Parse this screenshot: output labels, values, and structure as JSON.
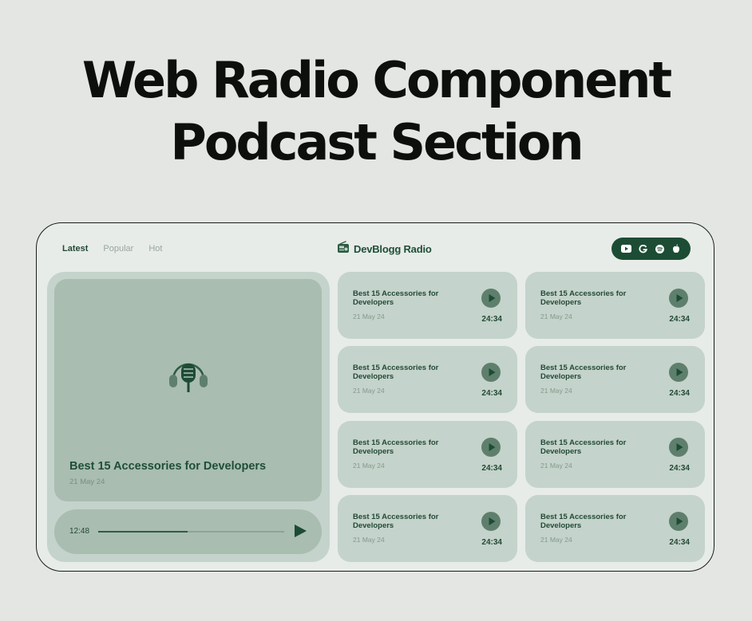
{
  "headline": {
    "line1": "Web Radio Component",
    "line2": "Podcast Section"
  },
  "header": {
    "tabs": [
      {
        "label": "Latest",
        "active": true
      },
      {
        "label": "Popular",
        "active": false
      },
      {
        "label": "Hot",
        "active": false
      }
    ],
    "brand": {
      "icon": "radio-icon",
      "name": "DevBlogg Radio"
    },
    "platforms": [
      "youtube-icon",
      "google-icon",
      "spotify-icon",
      "apple-icon"
    ]
  },
  "featured": {
    "icon": "podcast-microphone-headphones-icon",
    "title": "Best 15 Accessories for Developers",
    "date": "21 May 24",
    "player": {
      "time": "12:48",
      "progress": 0.48,
      "play_icon": "play-icon"
    }
  },
  "episodes": [
    {
      "title": "Best 15 Accessories for Developers",
      "date": "21 May 24",
      "duration": "24:34"
    },
    {
      "title": "Best 15 Accessories for Developers",
      "date": "21 May 24",
      "duration": "24:34"
    },
    {
      "title": "Best 15 Accessories for Developers",
      "date": "21 May 24",
      "duration": "24:34"
    },
    {
      "title": "Best 15 Accessories for Developers",
      "date": "21 May 24",
      "duration": "24:34"
    },
    {
      "title": "Best 15 Accessories for Developers",
      "date": "21 May 24",
      "duration": "24:34"
    },
    {
      "title": "Best 15 Accessories for Developers",
      "date": "21 May 24",
      "duration": "24:34"
    },
    {
      "title": "Best 15 Accessories for Developers",
      "date": "21 May 24",
      "duration": "24:34"
    },
    {
      "title": "Best 15 Accessories for Developers",
      "date": "21 May 24",
      "duration": "24:34"
    }
  ],
  "colors": {
    "background": "#e4e6e3",
    "card": "#e7ece9",
    "tile": "#c4d3cb",
    "cover": "#a9bdb1",
    "accent_dark": "#1d4c34",
    "play_button": "#5f7f6d"
  }
}
